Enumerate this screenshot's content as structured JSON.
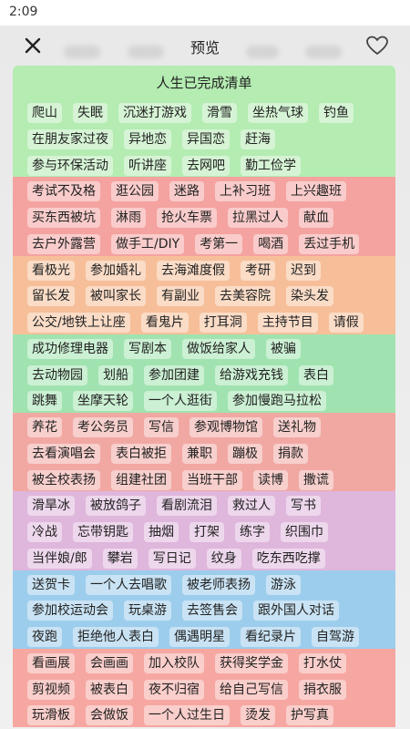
{
  "status_bar": {
    "time": "2:09"
  },
  "header": {
    "title": "预览",
    "close_icon": "close-icon",
    "heart_icon": "heart-icon"
  },
  "card": {
    "title": "人生已完成清单",
    "bands": [
      {
        "color": "#b4ecb2",
        "rows": 3
      },
      {
        "color": "#f4a3a0",
        "rows": 3
      },
      {
        "color": "#f6bf99",
        "rows": 3
      },
      {
        "color": "#a0e3b0",
        "rows": 3
      },
      {
        "color": "#f1a8a3",
        "rows": 3
      },
      {
        "color": "#dfb6dc",
        "rows": 3
      },
      {
        "color": "#9dcdec",
        "rows": 3
      },
      {
        "color": "#f6a7a1",
        "rows": 3
      }
    ],
    "rows": [
      [
        "爬山",
        "失眠",
        "沉迷打游戏",
        "滑雪",
        "坐热气球",
        "钓鱼"
      ],
      [
        "在朋友家过夜",
        "异地恋",
        "异国恋",
        "赶海"
      ],
      [
        "参与环保活动",
        "听讲座",
        "去网吧",
        "勤工俭学"
      ],
      [
        "考试不及格",
        "逛公园",
        "迷路",
        "上补习班",
        "上兴趣班"
      ],
      [
        "买东西被坑",
        "淋雨",
        "抢火车票",
        "拉黑过人",
        "献血"
      ],
      [
        "去户外露营",
        "做手工/DIY",
        "考第一",
        "喝酒",
        "丢过手机"
      ],
      [
        "看极光",
        "参加婚礼",
        "去海滩度假",
        "考研",
        "迟到"
      ],
      [
        "留长发",
        "被叫家长",
        "有副业",
        "去美容院",
        "染头发"
      ],
      [
        "公交/地铁上让座",
        "看鬼片",
        "打耳洞",
        "主持节目",
        "请假"
      ],
      [
        "成功修理电器",
        "写剧本",
        "做饭给家人",
        "被骗"
      ],
      [
        "去动物园",
        "划船",
        "参加团建",
        "给游戏充钱",
        "表白"
      ],
      [
        "跳舞",
        "坐摩天轮",
        "一个人逛街",
        "参加慢跑马拉松"
      ],
      [
        "养花",
        "考公务员",
        "写信",
        "参观博物馆",
        "送礼物"
      ],
      [
        "去看演唱会",
        "表白被拒",
        "兼职",
        "蹦极",
        "捐款"
      ],
      [
        "被全校表扬",
        "组建社团",
        "当班干部",
        "读博",
        "撒谎"
      ],
      [
        "滑旱冰",
        "被放鸽子",
        "看剧流泪",
        "救过人",
        "写书"
      ],
      [
        "冷战",
        "忘带钥匙",
        "抽烟",
        "打架",
        "练字",
        "织围巾"
      ],
      [
        "当伴娘/郎",
        "攀岩",
        "写日记",
        "纹身",
        "吃东西吃撑"
      ],
      [
        "送贺卡",
        "一个人去唱歌",
        "被老师表扬",
        "游泳"
      ],
      [
        "参加校运动会",
        "玩桌游",
        "去签售会",
        "跟外国人对话"
      ],
      [
        "夜跑",
        "拒绝他人表白",
        "偶遇明星",
        "看纪录片",
        "自驾游"
      ],
      [
        "看画展",
        "会画画",
        "加入校队",
        "获得奖学金",
        "打水仗"
      ],
      [
        "剪视频",
        "被表白",
        "夜不归宿",
        "给自己写信",
        "捐衣服"
      ],
      [
        "玩滑板",
        "会做饭",
        "一个人过生日",
        "烫发",
        "护写真"
      ]
    ]
  }
}
